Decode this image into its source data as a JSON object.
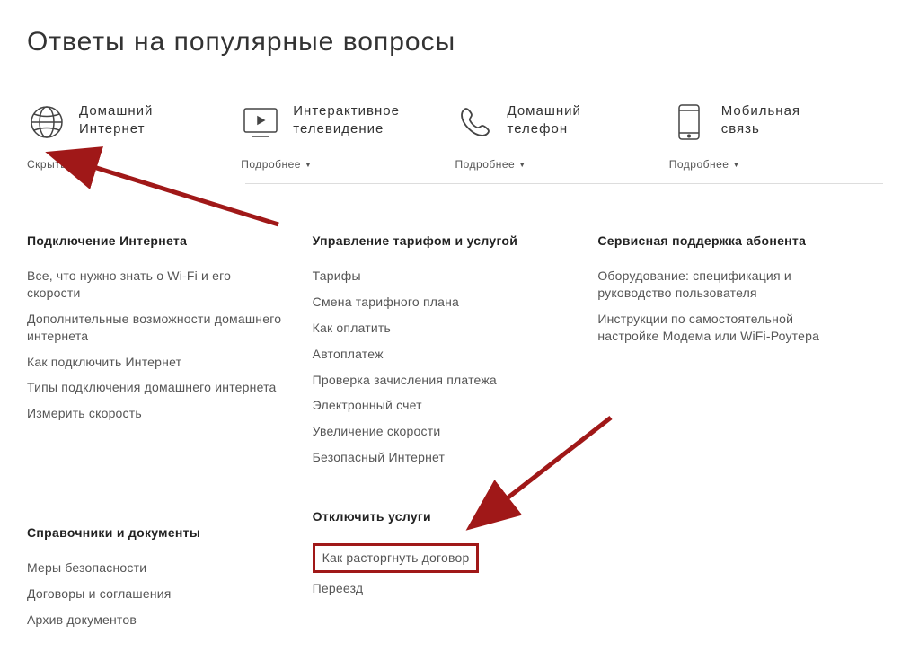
{
  "page_title": "Ответы на популярные вопросы",
  "categories": [
    {
      "title_line1": "Домашний",
      "title_line2": "Интернет",
      "toggle": "Скрыть",
      "arrow": "▲"
    },
    {
      "title_line1": "Интерактивное",
      "title_line2": "телевидение",
      "toggle": "Подробнее",
      "arrow": "▼"
    },
    {
      "title_line1": "Домашний",
      "title_line2": "телефон",
      "toggle": "Подробнее",
      "arrow": "▼"
    },
    {
      "title_line1": "Мобильная",
      "title_line2": "связь",
      "toggle": "Подробнее",
      "arrow": "▼"
    }
  ],
  "sections": {
    "col1": [
      {
        "heading": "Подключение Интернета",
        "links": [
          "Все, что нужно знать о Wi-Fi и его скорости",
          "Дополнительные возможности домашнего интернета",
          "Как подключить Интернет",
          "Типы подключения домашнего интернета",
          "Измерить скорость"
        ]
      },
      {
        "heading": "Справочники и документы",
        "links": [
          "Меры безопасности",
          "Договоры и соглашения",
          "Архив документов"
        ]
      }
    ],
    "col2": [
      {
        "heading": "Управление тарифом и услугой",
        "links": [
          "Тарифы",
          "Смена тарифного плана",
          "Как оплатить",
          "Автоплатеж",
          "Проверка зачисления платежа",
          "Электронный счет",
          "Увеличение скорости",
          "Безопасный Интернет"
        ]
      },
      {
        "heading": "Отключить услуги",
        "highlight": "Как расторгнуть договор",
        "links": [
          "Переезд"
        ]
      }
    ],
    "col3": [
      {
        "heading": "Сервисная поддержка абонента",
        "links": [
          "Оборудование: спецификация и руководство пользователя",
          "Инструкции по самостоятельной настройке Модема или WiFi-Роутера"
        ]
      }
    ]
  }
}
